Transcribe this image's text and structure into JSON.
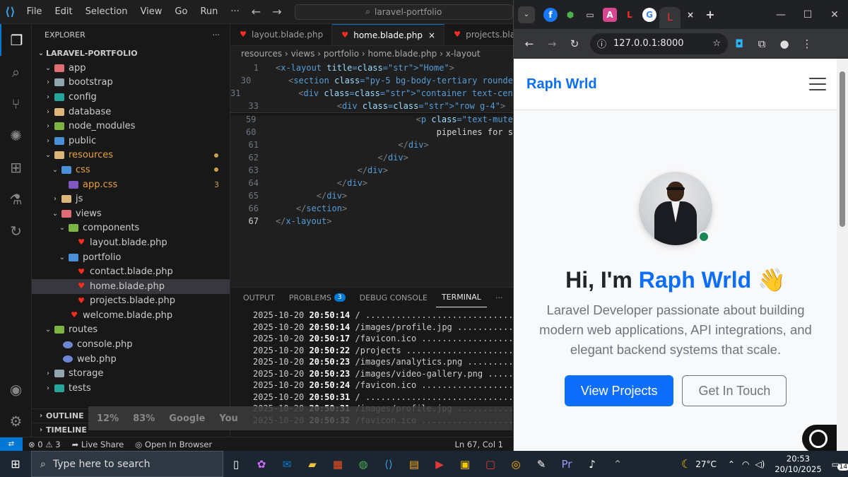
{
  "vscode": {
    "menu": [
      "File",
      "Edit",
      "Selection",
      "View",
      "Go",
      "Run",
      "···"
    ],
    "search_text": "laravel-portfolio",
    "explorer_title": "EXPLORER",
    "project_name": "LARAVEL-PORTFOLIO",
    "tree": [
      {
        "label": "app",
        "depth": 1,
        "kind": "folder-red",
        "open": true
      },
      {
        "label": "bootstrap",
        "depth": 1,
        "kind": "folder-gray"
      },
      {
        "label": "config",
        "depth": 1,
        "kind": "folder-teal"
      },
      {
        "label": "database",
        "depth": 1,
        "kind": "folder-yellow"
      },
      {
        "label": "node_modules",
        "depth": 1,
        "kind": "folder-green"
      },
      {
        "label": "public",
        "depth": 1,
        "kind": "folder-blue"
      },
      {
        "label": "resources",
        "depth": 1,
        "kind": "folder-yellow",
        "open": true,
        "modified": true
      },
      {
        "label": "css",
        "depth": 2,
        "kind": "folder-blue",
        "open": true,
        "modified": true
      },
      {
        "label": "app.css",
        "depth": 3,
        "kind": "css",
        "badge": "3"
      },
      {
        "label": "js",
        "depth": 2,
        "kind": "folder-yellow"
      },
      {
        "label": "views",
        "depth": 2,
        "kind": "folder-red",
        "open": true
      },
      {
        "label": "components",
        "depth": 3,
        "kind": "folder-green",
        "open": true
      },
      {
        "label": "layout.blade.php",
        "depth": 4,
        "kind": "blade"
      },
      {
        "label": "portfolio",
        "depth": 3,
        "kind": "folder-blue",
        "open": true
      },
      {
        "label": "contact.blade.php",
        "depth": 4,
        "kind": "blade"
      },
      {
        "label": "home.blade.php",
        "depth": 4,
        "kind": "blade",
        "selected": true
      },
      {
        "label": "projects.blade.php",
        "depth": 4,
        "kind": "blade"
      },
      {
        "label": "welcome.blade.php",
        "depth": 3,
        "kind": "blade"
      },
      {
        "label": "routes",
        "depth": 1,
        "kind": "folder-green",
        "open": true
      },
      {
        "label": "console.php",
        "depth": 2,
        "kind": "php"
      },
      {
        "label": "web.php",
        "depth": 2,
        "kind": "php"
      },
      {
        "label": "storage",
        "depth": 1,
        "kind": "folder-gray"
      },
      {
        "label": "tests",
        "depth": 1,
        "kind": "folder-teal"
      }
    ],
    "outline": "OUTLINE",
    "timeline": "TIMELINE",
    "overlay_stats": [
      "12%",
      "83%",
      "Google",
      "You"
    ],
    "tabs": [
      "layout.blade.php",
      "home.blade.php",
      "projects.blade"
    ],
    "breadcrumb": "resources › views › portfolio › home.blade.php › x-layout",
    "code_sticky": [
      {
        "ln": "1",
        "code": "<x-layout title=\"Home\">"
      },
      {
        "ln": "30",
        "code": "    <section class=\"py-5 bg-body-tertiary rounde"
      },
      {
        "ln": "31",
        "code": "        <div class=\"container text-center\">"
      },
      {
        "ln": "33",
        "code": "            <div class=\"row g-4\">"
      }
    ],
    "code_lines": [
      {
        "ln": "59",
        "code": "                            <p class=\"text-mute"
      },
      {
        "ln": "60",
        "code": "                                pipelines for s"
      },
      {
        "ln": "61",
        "code": "                        </div>"
      },
      {
        "ln": "62",
        "code": "                    </div>"
      },
      {
        "ln": "63",
        "code": "                </div>"
      },
      {
        "ln": "64",
        "code": "            </div>"
      },
      {
        "ln": "65",
        "code": "        </div>"
      },
      {
        "ln": "66",
        "code": "    </section>"
      },
      {
        "ln": "67",
        "code": "</x-layout>"
      }
    ],
    "panel_tabs": [
      "OUTPUT",
      "PROBLEMS",
      "DEBUG CONSOLE",
      "TERMINAL"
    ],
    "problems_count": "3",
    "terminal": [
      {
        "date": "2025-10-20",
        "time": "20:50:14",
        "path": "/ ..............................."
      },
      {
        "date": "2025-10-20",
        "time": "20:50:14",
        "path": "/images/profile.jpg ..............."
      },
      {
        "date": "2025-10-20",
        "time": "20:50:17",
        "path": "/favicon.ico ......................"
      },
      {
        "date": "2025-10-20",
        "time": "20:50:22",
        "path": "/projects ........................."
      },
      {
        "date": "2025-10-20",
        "time": "20:50:23",
        "path": "/images/analytics.png .............."
      },
      {
        "date": "2025-10-20",
        "time": "20:50:23",
        "path": "/images/video-gallery.png .........."
      },
      {
        "date": "2025-10-20",
        "time": "20:50:24",
        "path": "/favicon.ico ......................"
      },
      {
        "date": "2025-10-20",
        "time": "20:50:31",
        "path": "/ ..............................."
      },
      {
        "date": "2025-10-20",
        "time": "20:50:31",
        "path": "/images/profile.jpg ..............."
      },
      {
        "date": "2025-10-20",
        "time": "20:50:32",
        "path": "/favicon.ico ......................"
      }
    ],
    "status": {
      "errors": "0",
      "warnings": "3",
      "live_share": "Live Share",
      "open_browser": "Open In Browser",
      "position": "Ln 67, Col 1"
    }
  },
  "browser": {
    "url": "127.0.0.1:8000",
    "favicons": [
      "f",
      "⬢",
      "▭",
      "A",
      "L",
      "G",
      "L"
    ],
    "brand": "Raph Wrld",
    "greeting": "Hi, I'm",
    "name": "Raph Wrld",
    "wave": "👋",
    "lead": "Laravel Developer passionate about building modern web applications, API integrations, and elegant backend systems that scale.",
    "btn_primary": "View Projects",
    "btn_secondary": "Get In Touch"
  },
  "taskbar": {
    "search_placeholder": "Type here to search",
    "temperature": "27°C",
    "time": "20:53",
    "date": "20/10/2025",
    "notifications": "14"
  }
}
